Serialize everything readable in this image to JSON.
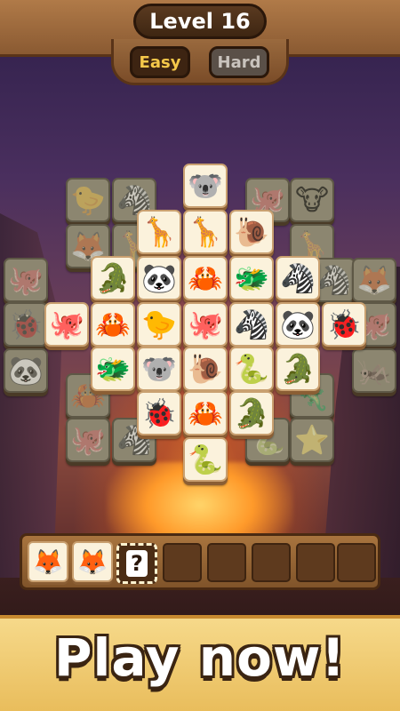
{
  "header": {
    "level_label": "Level 16",
    "easy_label": "Easy",
    "hard_label": "Hard"
  },
  "tiles": {
    "bottom_left_octopus": "🐙",
    "bottom_left_ladybug": "🐞",
    "bottom_left_panda": "🐼",
    "back_chick": "🐤",
    "back_zebra": "🦓",
    "back_octopus_top": "🐙",
    "back_cow": "🐮",
    "back_fox": "🦊",
    "back_giraffe_left": "🦒",
    "back_giraffe_right": "🦒",
    "back_zebra_right": "🦓",
    "back_fox_right": "🦊",
    "back_octopus_right": "🐙",
    "back_dragonfly": "🦗",
    "back_crab_left": "🦀",
    "back_octopus_low": "🐙",
    "back_zebra_low": "🦓",
    "back_starfish": "⭐",
    "back_snake_low": "🐍",
    "back_dino_low": "🦎",
    "koala_top": "🐨",
    "giraffe_1": "🦒",
    "giraffe_2": "🦒",
    "snail_top": "🐌",
    "croc_1": "🐊",
    "panda_1": "🐼",
    "crab_1": "🦀",
    "dragon_1": "🐲",
    "zebra_1": "🦓",
    "octopus_1": "🐙",
    "crab_2": "🦀",
    "chick_1": "🐤",
    "octopus_2": "🐙",
    "zebra_2": "🦓",
    "panda_2": "🐼",
    "ladybug_1": "🐞",
    "dragon_2": "🐲",
    "koala_2": "🐨",
    "snail_2": "🐌",
    "snake_1": "🐍",
    "croc_2": "🐊",
    "ladybug_2": "🐞",
    "crab_3": "🦀",
    "croc_3": "🐊",
    "snake_2": "🐍"
  },
  "tray": {
    "slot_1": "🦊",
    "slot_2": "🦊",
    "hint_symbol": "?"
  },
  "banner": {
    "text": "Play now!"
  }
}
